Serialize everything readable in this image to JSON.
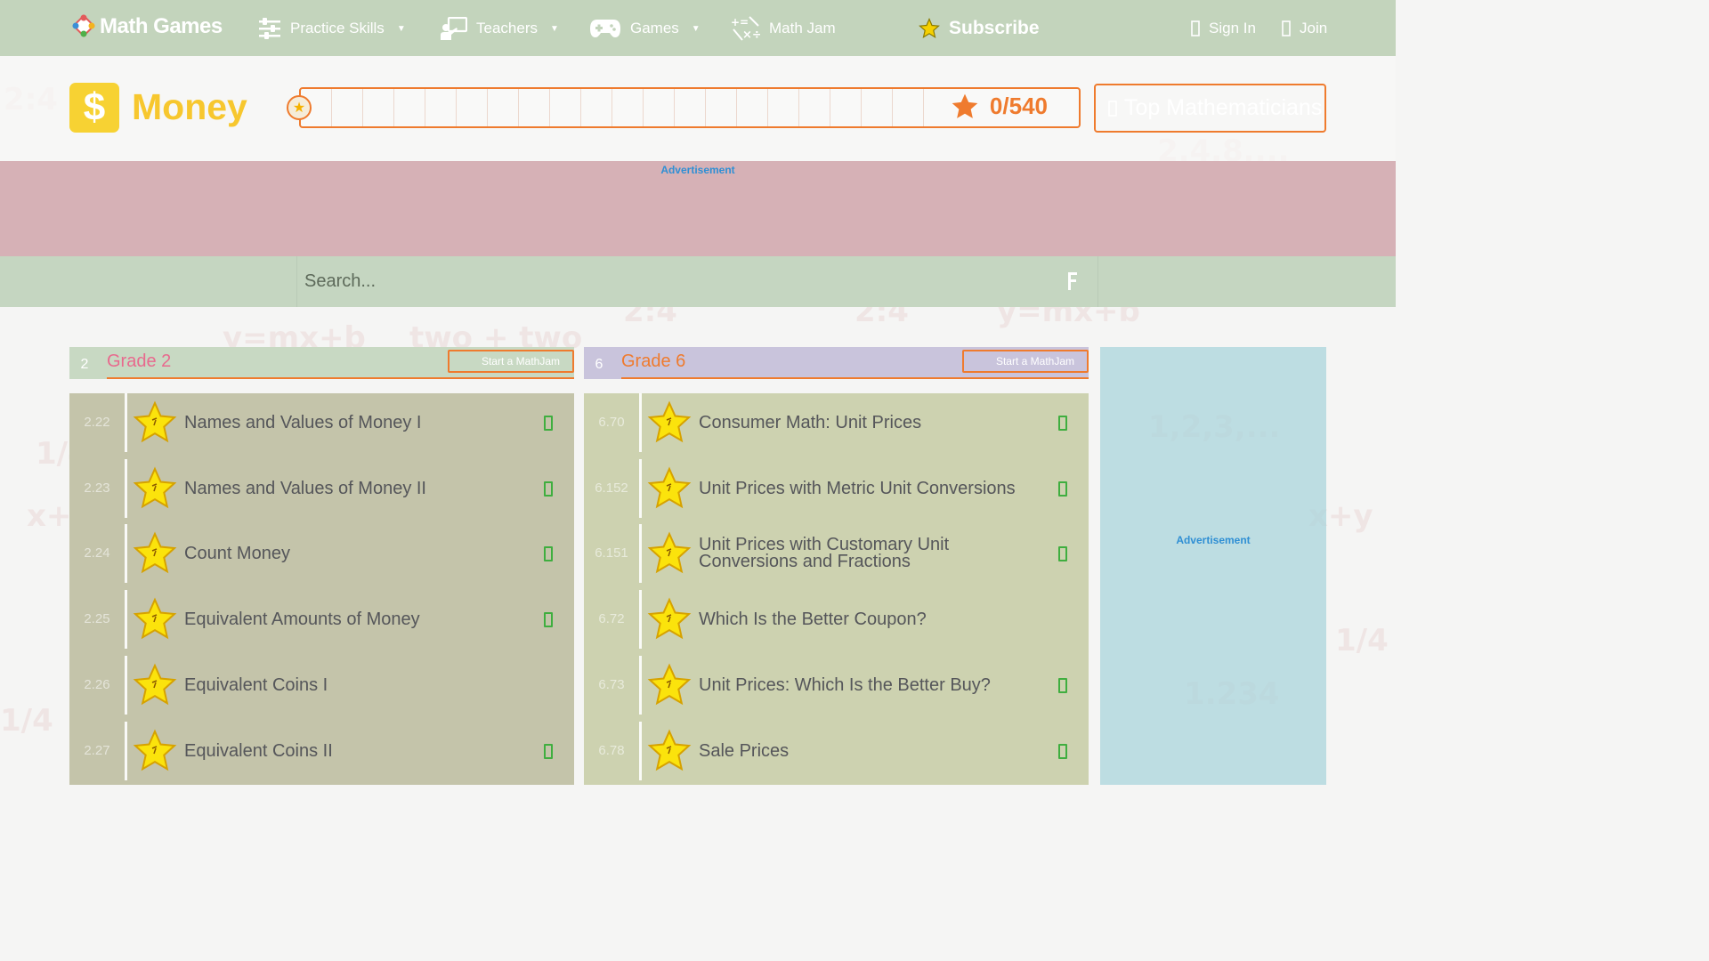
{
  "brand": {
    "name": "Math Games"
  },
  "nav": {
    "items": [
      {
        "label": "Practice Skills",
        "icon": "sliders-icon",
        "has_caret": true
      },
      {
        "label": "Teachers",
        "icon": "teacher-icon",
        "has_caret": true
      },
      {
        "label": "Games",
        "icon": "gamepad-icon",
        "has_caret": true
      },
      {
        "label": "Math Jam",
        "icon": "math-jam-icon",
        "has_caret": false
      }
    ],
    "subscribe_label": "Subscribe",
    "sign_in_label": "Sign In",
    "join_label": "Join"
  },
  "topic": {
    "title": "Money",
    "icon_glyph": "$",
    "score": "0/540",
    "progress_fraction": 0.0,
    "top_mathematicians_label": "Top Mathematicians"
  },
  "ads": {
    "label": "Advertisement"
  },
  "search": {
    "placeholder": "Search..."
  },
  "grades": [
    {
      "number": "2",
      "name": "Grade 2",
      "jam_label": "Start a MathJam",
      "skills": [
        {
          "code": "2.22",
          "title": "Names and Values of Money I",
          "checked": true
        },
        {
          "code": "2.23",
          "title": "Names and Values of Money II",
          "checked": true
        },
        {
          "code": "2.24",
          "title": "Count Money",
          "checked": true
        },
        {
          "code": "2.25",
          "title": "Equivalent Amounts of Money",
          "checked": true
        },
        {
          "code": "2.26",
          "title": "Equivalent Coins I",
          "checked": false
        },
        {
          "code": "2.27",
          "title": "Equivalent Coins II",
          "checked": true
        }
      ]
    },
    {
      "number": "6",
      "name": "Grade 6",
      "jam_label": "Start a MathJam",
      "skills": [
        {
          "code": "6.70",
          "title": "Consumer Math: Unit Prices",
          "checked": true
        },
        {
          "code": "6.152",
          "title": "Unit Prices with Metric Unit Conversions",
          "checked": true
        },
        {
          "code": "6.151",
          "title": "Unit Prices with Customary Unit Conversions and Fractions",
          "checked": true
        },
        {
          "code": "6.72",
          "title": "Which Is the Better Coupon?",
          "checked": false
        },
        {
          "code": "6.73",
          "title": "Unit Prices: Which Is the Better Buy?",
          "checked": true
        },
        {
          "code": "6.78",
          "title": "Sale Prices",
          "checked": true
        }
      ]
    }
  ],
  "colors": {
    "nav_bg": "#c3d4bc",
    "accent_orange": "#ef7b2e",
    "money_yellow": "#f7d233",
    "grade2_pink": "#e86a8e",
    "check_green": "#3fae3f",
    "ad_blue": "#2f8fd4"
  }
}
